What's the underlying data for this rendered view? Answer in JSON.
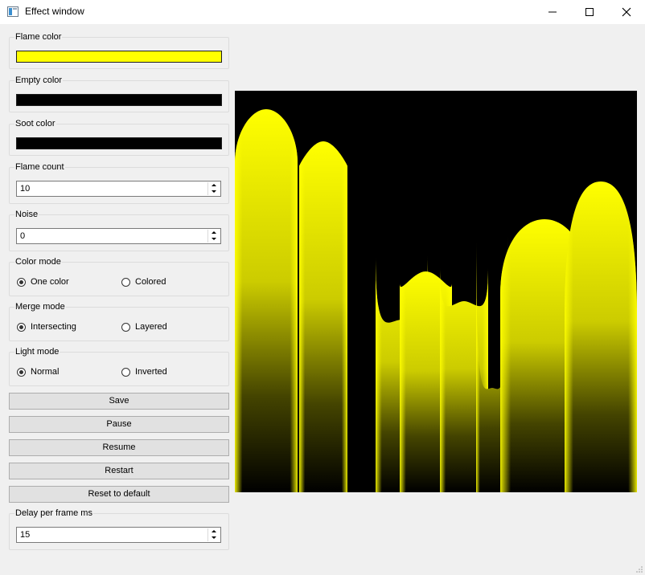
{
  "window": {
    "title": "Effect window",
    "minimize_icon": "minimize-icon",
    "maximize_icon": "maximize-icon",
    "close_icon": "close-icon"
  },
  "flame_color": {
    "label": "Flame color",
    "value": "#ffff00"
  },
  "empty_color": {
    "label": "Empty color",
    "value": "#000000"
  },
  "soot_color": {
    "label": "Soot color",
    "value": "#000000"
  },
  "flame_count": {
    "label": "Flame count",
    "value": "10"
  },
  "noise": {
    "label": "Noise",
    "value": "0"
  },
  "color_mode": {
    "label": "Color mode",
    "options": [
      "One color",
      "Colored"
    ],
    "selected": "One color"
  },
  "merge_mode": {
    "label": "Merge mode",
    "options": [
      "Intersecting",
      "Layered"
    ],
    "selected": "Intersecting"
  },
  "light_mode": {
    "label": "Light mode",
    "options": [
      "Normal",
      "Inverted"
    ],
    "selected": "Normal"
  },
  "buttons": {
    "save": "Save",
    "pause": "Pause",
    "resume": "Resume",
    "restart": "Restart",
    "reset": "Reset to default"
  },
  "delay": {
    "label": "Delay per frame ms",
    "value": "15"
  },
  "colors": {
    "flame": "#ffff00",
    "background": "#000000",
    "window_bg": "#f0f0f0"
  }
}
